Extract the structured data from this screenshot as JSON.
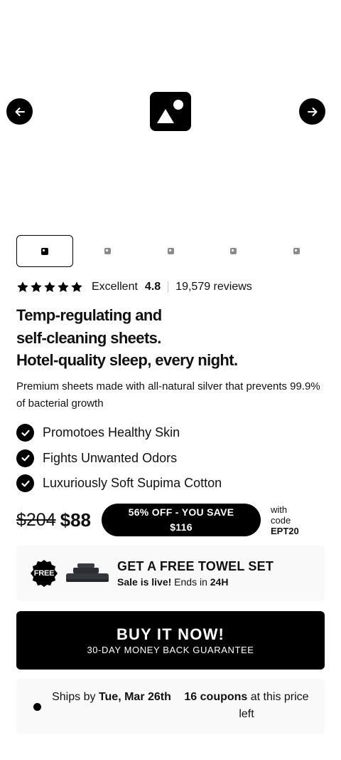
{
  "gallery": {
    "prev_icon": "arrow-left-icon",
    "next_icon": "arrow-right-icon",
    "image_icon": "image-placeholder-icon",
    "thumbnail_count": 5,
    "active_thumbnail": 1
  },
  "rating": {
    "stars": 5,
    "label": "Excellent",
    "score": "4.8",
    "reviews": "19,579 reviews"
  },
  "product": {
    "title_lines": [
      "Temp-regulating and",
      "self-cleaning sheets.",
      "Hotel-quality sleep, every night."
    ],
    "subtitle": "Premium sheets made with all-natural silver that prevents 99.9% of bacterial growth",
    "benefits": [
      "Promotoes Healthy Skin",
      "Fights Unwanted Odors",
      "Luxuriously Soft Supima Cotton"
    ]
  },
  "pricing": {
    "old_price": "$204",
    "new_price": "$88",
    "save_line1": "56% OFF - YOU SAVE",
    "save_line2": "$116",
    "code_prefix_1": "with",
    "code_prefix_2": "code",
    "code": "EPT20"
  },
  "offer": {
    "badge": "FREE",
    "headline": "GET A FREE TOWEL SET",
    "sale_text": "Sale is live!",
    "ends_text": "Ends in",
    "ends_time": "24H"
  },
  "cta": {
    "label": "BUY IT NOW!",
    "sublabel": "30-DAY MONEY BACK GUARANTEE"
  },
  "shipping": {
    "ships_by_prefix": "Ships by",
    "ships_by_date": "Tue, Mar 26th",
    "coupons_bold": "16 coupons",
    "coupons_rest": "at this price left"
  },
  "colors": {
    "primary": "#000000",
    "card_bg": "#f9f9f9",
    "text": "#111111"
  }
}
